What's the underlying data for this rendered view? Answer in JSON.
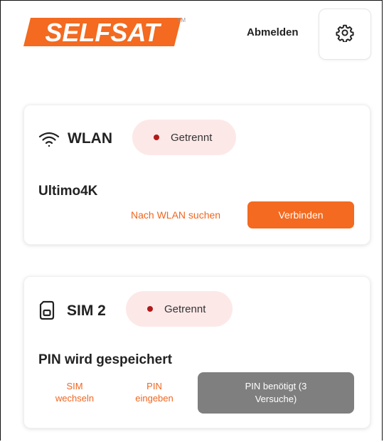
{
  "header": {
    "logo_text": "SELFSAT",
    "trademark": "TM",
    "logout_label": "Abmelden"
  },
  "wlan": {
    "title": "WLAN",
    "status": "Getrennt",
    "network_name": "Ultimo4K",
    "search_label": "Nach WLAN suchen",
    "connect_label": "Verbinden"
  },
  "sim": {
    "title": "SIM 2",
    "status": "Getrennt",
    "message": "PIN wird gespeichert",
    "switch_sim_line1": "SIM",
    "switch_sim_line2": "wechseln",
    "enter_pin_line1": "PIN",
    "enter_pin_line2": "eingeben",
    "pin_required_line1": "PIN benötigt (3",
    "pin_required_line2": "Versuche)"
  },
  "colors": {
    "accent": "#f36a20",
    "status_bg": "#fde8e8",
    "status_dot": "#b11a1a",
    "disabled": "#7f7f7f"
  },
  "icons": {
    "settings": "gear-icon",
    "wlan": "wifi-icon",
    "sim": "sim-card-icon"
  }
}
